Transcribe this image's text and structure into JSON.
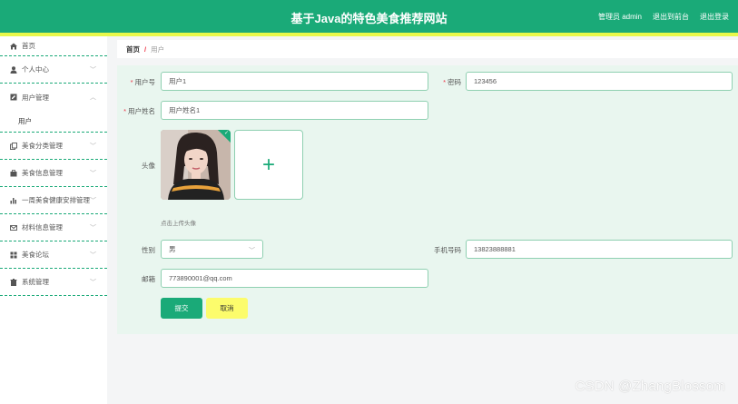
{
  "header": {
    "title": "基于Java的特色美食推荐网站",
    "admin_label": "管理员 admin",
    "front_link": "退出到前台",
    "logout_link": "退出登录"
  },
  "colors": {
    "primary": "#1aaa78",
    "stripe": "#e8f84a",
    "cancel": "#fcfc6c",
    "panel": "#e9f6ef"
  },
  "sidebar": {
    "items": [
      {
        "label": "首页",
        "icon": "home-icon"
      },
      {
        "label": "个人中心",
        "icon": "user-icon"
      },
      {
        "label": "用户管理",
        "icon": "edit-icon",
        "expanded": true
      },
      {
        "label": "美食分类管理",
        "icon": "copy-icon"
      },
      {
        "label": "美食信息管理",
        "icon": "briefcase-icon"
      },
      {
        "label": "一周美食健康安排管理",
        "icon": "bar-chart-icon"
      },
      {
        "label": "材料信息管理",
        "icon": "mail-icon"
      },
      {
        "label": "美食论坛",
        "icon": "grid-icon"
      },
      {
        "label": "系统管理",
        "icon": "trash-icon"
      }
    ],
    "sub_item": "用户"
  },
  "breadcrumb": {
    "home": "首页",
    "separator": "/",
    "current": "用户"
  },
  "form": {
    "username_label": "用户号",
    "username_value": "用户1",
    "password_label": "密码",
    "password_value": "123456",
    "realname_label": "用户姓名",
    "realname_value": "用户姓名1",
    "avatar_label": "头像",
    "avatar_hint": "点击上传头像",
    "upload_plus": "+",
    "gender_label": "性别",
    "gender_value": "男",
    "phone_label": "手机号码",
    "phone_value": "13823888881",
    "email_label": "邮箱",
    "email_value": "773890001@qq.com",
    "submit_label": "提交",
    "cancel_label": "取消"
  },
  "watermark": "CSDN @ZhangBlossom"
}
